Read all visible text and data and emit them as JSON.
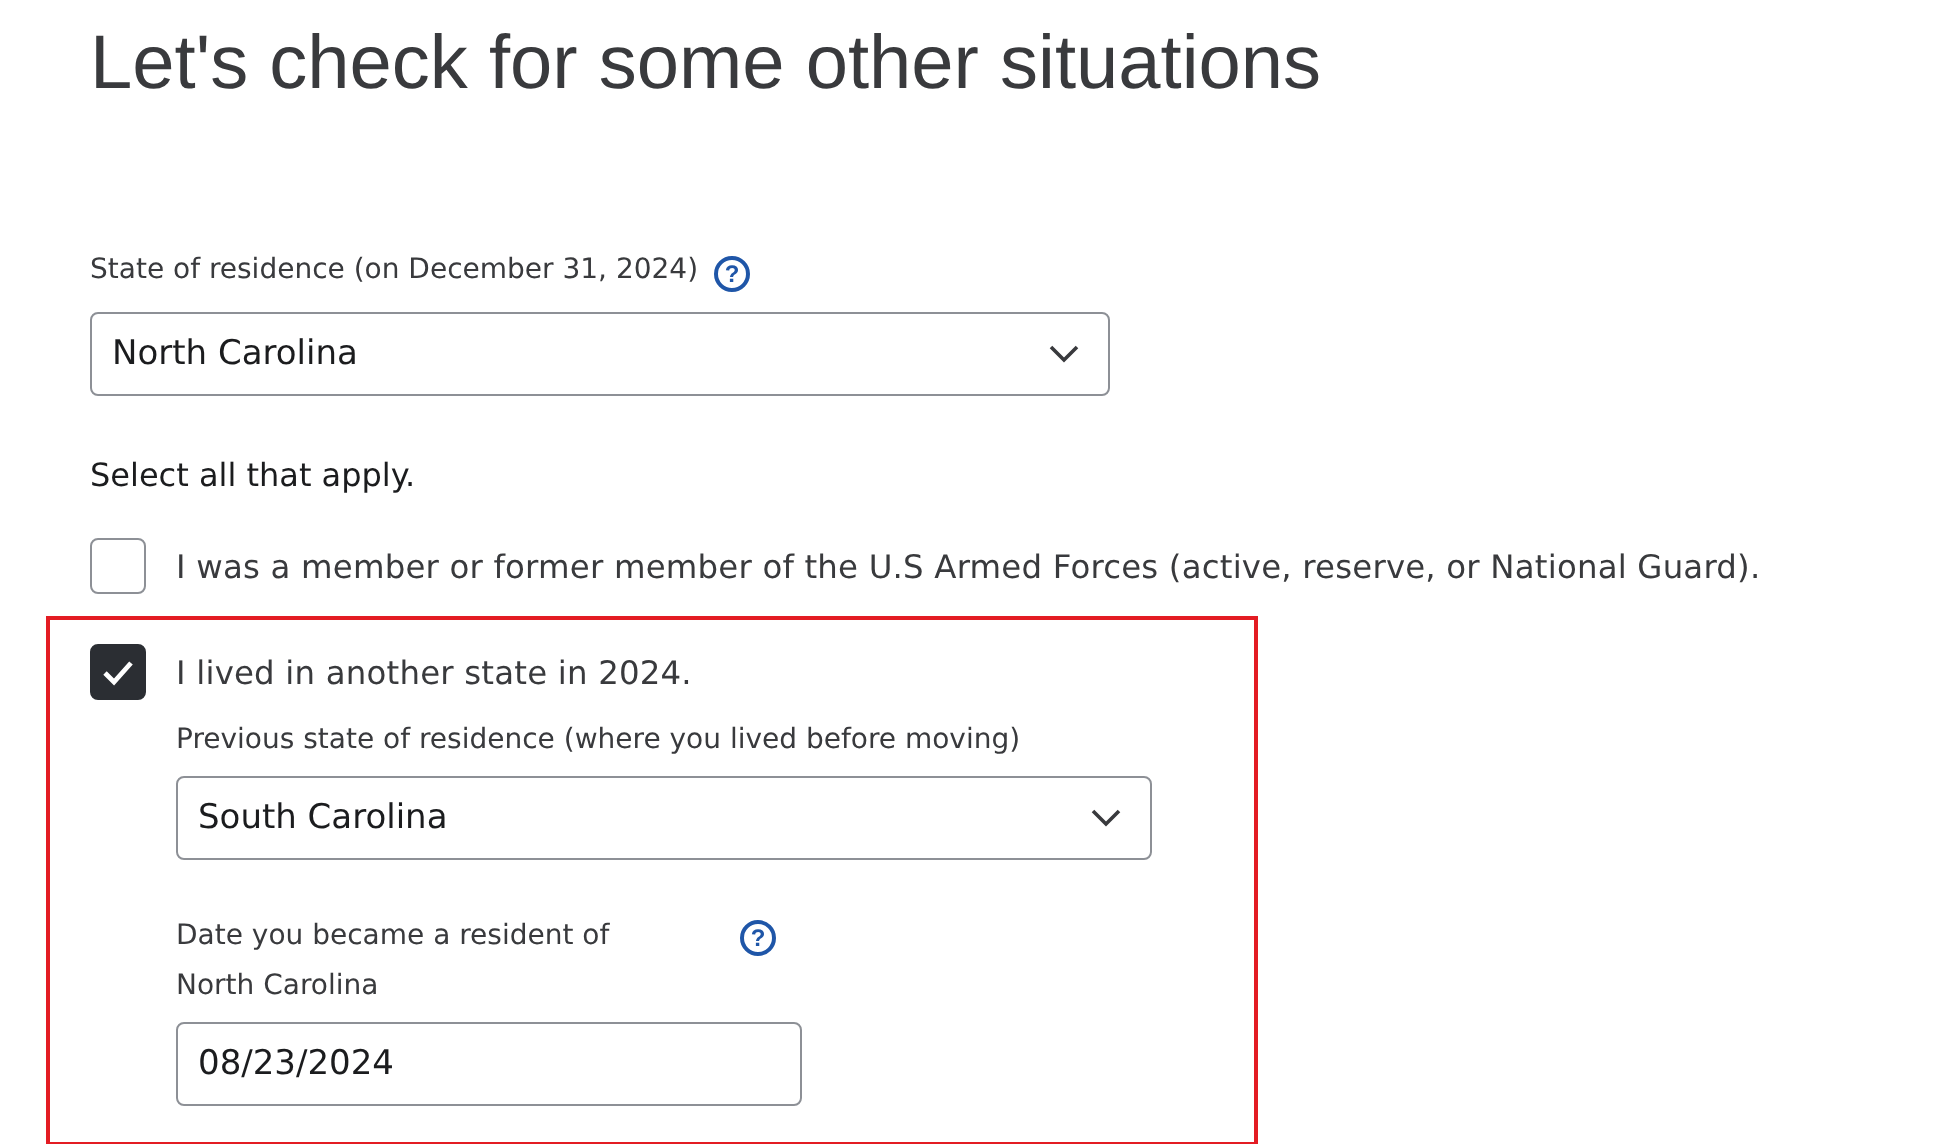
{
  "heading": "Let's check for some other situations",
  "state_field": {
    "label": "State of residence (on December 31, 2024)",
    "help": "?",
    "value": "North Carolina"
  },
  "instruction": "Select all that apply.",
  "options": [
    {
      "label": "I was a member or former member of the U.S Armed Forces (active, reserve, or National Guard).",
      "checked": false,
      "highlighted": false
    },
    {
      "label": "I lived in another state in 2024.",
      "checked": true,
      "highlighted": true,
      "fields": [
        {
          "kind": "select",
          "label": "Previous state of residence (where you lived before moving)",
          "value": "South Carolina"
        },
        {
          "kind": "date",
          "label": "Date you became a resident of North Carolina",
          "help": "?",
          "value": "08/23/2024"
        }
      ]
    }
  ]
}
